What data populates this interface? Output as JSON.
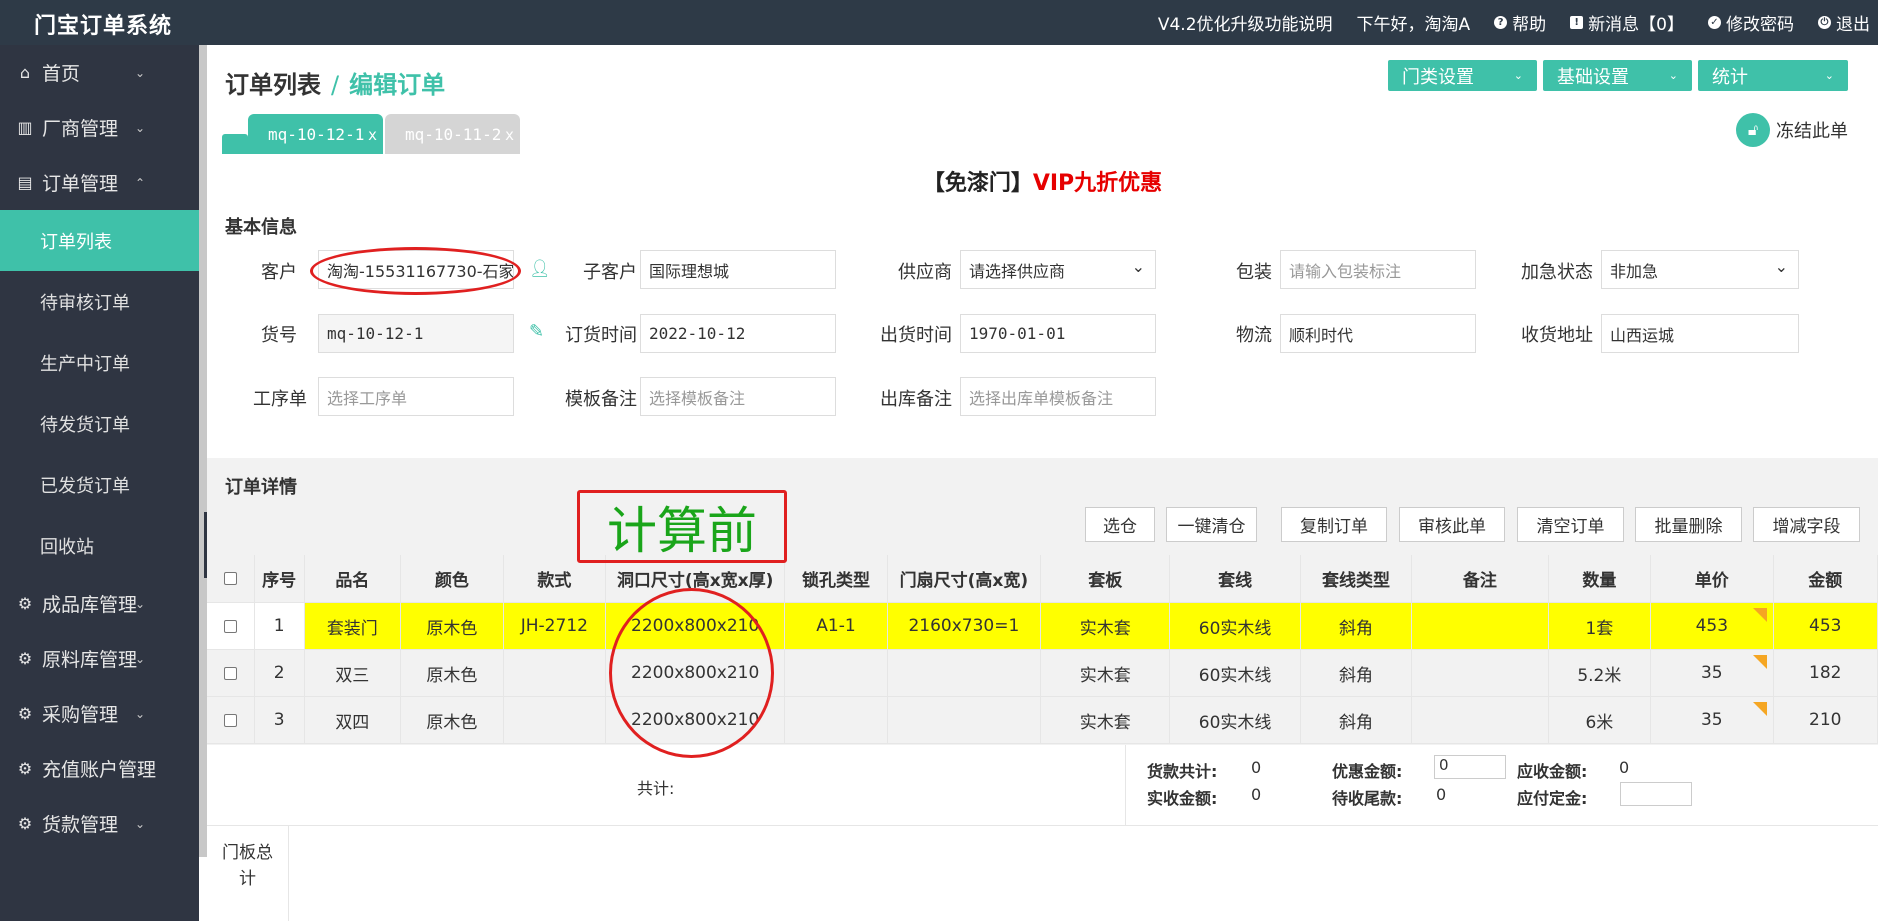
{
  "app": {
    "logo": "门宝订单系统",
    "topbar": {
      "version_note": "V4.2优化升级功能说明",
      "greeting": "下午好，淘淘A",
      "help": "帮助",
      "messages": "新消息【0】",
      "change_password": "修改密码",
      "logout": "退出"
    }
  },
  "sidebar": {
    "home": "首页",
    "vendor": "厂商管理",
    "orders": "订单管理",
    "order_subs": [
      "订单列表",
      "待审核订单",
      "生产中订单",
      "待发货订单",
      "已发货订单",
      "回收站"
    ],
    "finished_goods": "成品库管理",
    "raw_materials": "原料库管理",
    "purchase": "采购管理",
    "recharge": "充值账户管理",
    "payments": "货款管理"
  },
  "header": {
    "breadcrumb_parent": "订单列表",
    "breadcrumb_sep": "/",
    "breadcrumb_current": "编辑订单",
    "btn_door_settings": "门类设置",
    "btn_basic_settings": "基础设置",
    "btn_stats": "统计"
  },
  "tabs": [
    {
      "label": "mq-10-12-1",
      "close": "x"
    },
    {
      "label": "mq-10-11-2",
      "close": "x"
    }
  ],
  "freeze_label": "冻结此单",
  "notice": {
    "part1": "【免漆门】",
    "part2": "VIP九折优惠"
  },
  "basic": {
    "title": "基本信息",
    "customer_label": "客户",
    "customer_value": "淘淘-15531167730-石家",
    "subcustomer_label": "子客户",
    "subcustomer_value": "国际理想城",
    "supplier_label": "供应商",
    "supplier_value": "请选择供应商",
    "package_label": "包装",
    "package_placeholder": "请输入包装标注",
    "urgent_label": "加急状态",
    "urgent_value": "非加急",
    "goods_no_label": "货号",
    "goods_no_value": "mq-10-12-1",
    "order_time_label": "订货时间",
    "order_time_value": "2022-10-12",
    "ship_time_label": "出货时间",
    "ship_time_value": "1970-01-01",
    "logistics_label": "物流",
    "logistics_value": "顺利时代",
    "address_label": "收货地址",
    "address_value": "山西运城",
    "process_label": "工序单",
    "process_placeholder": "选择工序单",
    "template_label": "模板备注",
    "template_placeholder": "选择模板备注",
    "outbound_label": "出库备注",
    "outbound_placeholder": "选择出库单模板备注"
  },
  "detail": {
    "title": "订单详情",
    "annotation": "计算前",
    "actions": [
      "选仓",
      "一键清仓",
      "复制订单",
      "审核此单",
      "清空订单",
      "批量删除",
      "增减字段"
    ],
    "columns": [
      "序号",
      "品名",
      "颜色",
      "款式",
      "洞口尺寸(高x宽x厚)",
      "锁孔类型",
      "门扇尺寸(高x宽)",
      "套板",
      "套线",
      "套线类型",
      "备注",
      "数量",
      "单价",
      "金额"
    ],
    "rows": [
      [
        "1",
        "套装门",
        "原木色",
        "JH-2712",
        "2200x800x210",
        "A1-1",
        "2160x730=1",
        "实木套",
        "60实木线",
        "斜角",
        "",
        "1套",
        "453",
        "453"
      ],
      [
        "2",
        "双三",
        "原木色",
        "",
        "2200x800x210",
        "",
        "",
        "实木套",
        "60实木线",
        "斜角",
        "",
        "5.2米",
        "35",
        "182"
      ],
      [
        "3",
        "双四",
        "原木色",
        "",
        "2200x800x210",
        "",
        "",
        "实木套",
        "60实木线",
        "斜角",
        "",
        "6米",
        "35",
        "210"
      ]
    ]
  },
  "summary": {
    "total_label": "共计:",
    "goods_total_label": "货款共计:",
    "goods_total_value": "0",
    "discount_label": "优惠金额:",
    "discount_value": "0",
    "receivable_label": "应收金额:",
    "receivable_value": "0",
    "received_label": "实收金额:",
    "received_value": "0",
    "pending_label": "待收尾款:",
    "pending_value": "0",
    "deposit_label": "应付定金:",
    "deposit_value": ""
  },
  "door_total_label": "门板总计"
}
